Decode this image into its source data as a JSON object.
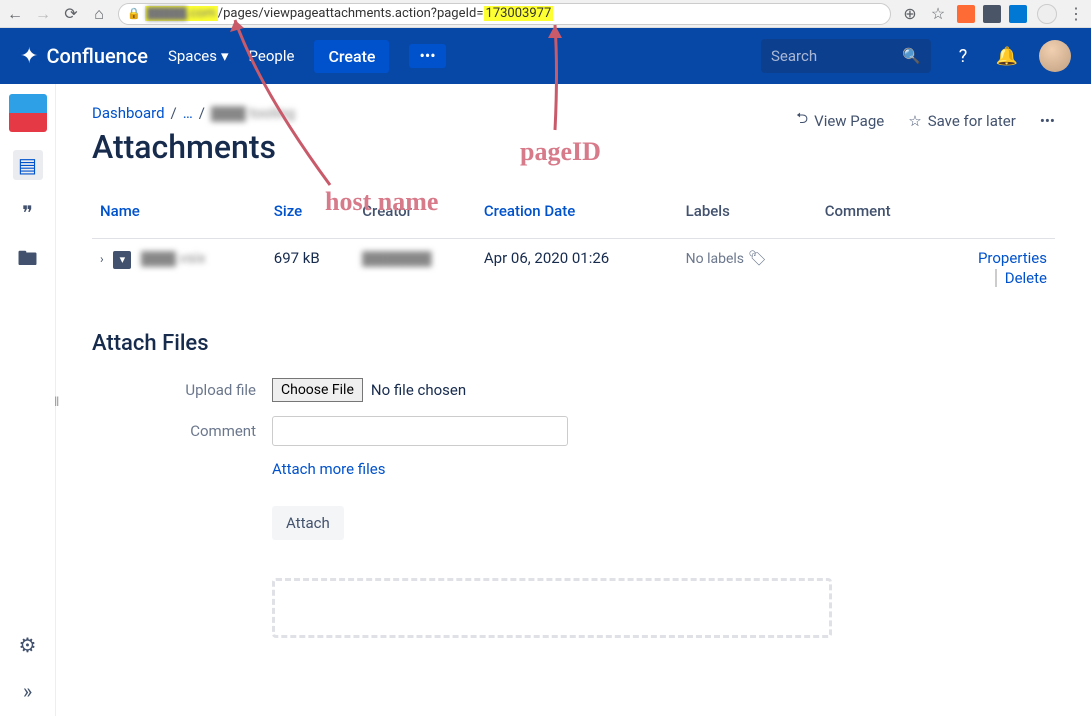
{
  "browser": {
    "url_host": "▇▇▇▇.com",
    "url_path": "/pages/viewpageattachments.action?pageId=",
    "url_pageid": "173003977",
    "ext_colors": [
      "#ff6b35",
      "#4a5568",
      "#0078d4"
    ]
  },
  "header": {
    "product": "Confluence",
    "spaces": "Spaces",
    "people": "People",
    "create": "Create",
    "search_placeholder": "Search"
  },
  "breadcrumbs": {
    "dashboard": "Dashboard",
    "ellipsis": "…",
    "current": "▇▇▇ tooling"
  },
  "page_actions": {
    "view": "View Page",
    "save": "Save for later"
  },
  "title": "Attachments",
  "table": {
    "headers": {
      "name": "Name",
      "size": "Size",
      "creator": "Creator",
      "date": "Creation Date",
      "labels": "Labels",
      "comment": "Comment"
    },
    "row": {
      "filename": "▇▇▇.vsix",
      "size": "697 kB",
      "creator": "▇▇▇▇▇▇",
      "date": "Apr 06, 2020 01:26",
      "labels": "No labels",
      "properties": "Properties",
      "delete": "Delete"
    }
  },
  "attach": {
    "heading": "Attach Files",
    "upload_label": "Upload file",
    "choose": "Choose File",
    "nofile": "No file chosen",
    "comment_label": "Comment",
    "more": "Attach more files",
    "button": "Attach"
  },
  "annotations": {
    "hostname": "host name",
    "pageid": "pageID"
  }
}
